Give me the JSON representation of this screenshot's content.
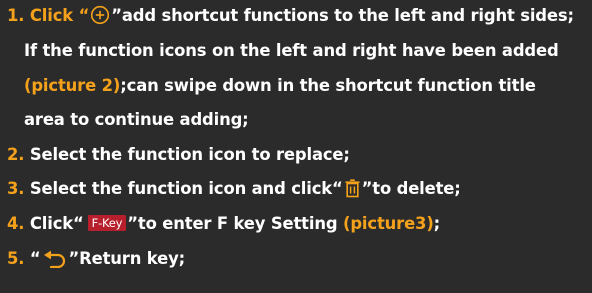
{
  "colors": {
    "background": "#2b2b2b",
    "text": "#ffffff",
    "accent": "#f4a11b",
    "fkey_badge": "#b81f2d"
  },
  "steps": [
    {
      "num": "1.",
      "head_pre": "Click “",
      "icon": "plus-circle-icon",
      "head_post": "”add shortcut functions to the left and right sides;",
      "cont1": "If the function icons on the left and right have been added",
      "cont2_accent": "(picture 2)",
      "cont2_rest": ";can swipe down in the shortcut function title",
      "cont3": "area to continue adding;"
    },
    {
      "num": "2.",
      "text": "Select the function icon to replace;"
    },
    {
      "num": "3.",
      "pre": "Select the function icon and click“",
      "icon": "trash-icon",
      "post": "”to delete;"
    },
    {
      "num": "4.",
      "pre": "Click“",
      "badge": "F-Key",
      "mid": "”to enter F key Setting",
      "accent": "(picture3)",
      "post": ";"
    },
    {
      "num": "5.",
      "pre": "“",
      "icon": "return-arrow-icon",
      "post": "”Return key;"
    }
  ]
}
